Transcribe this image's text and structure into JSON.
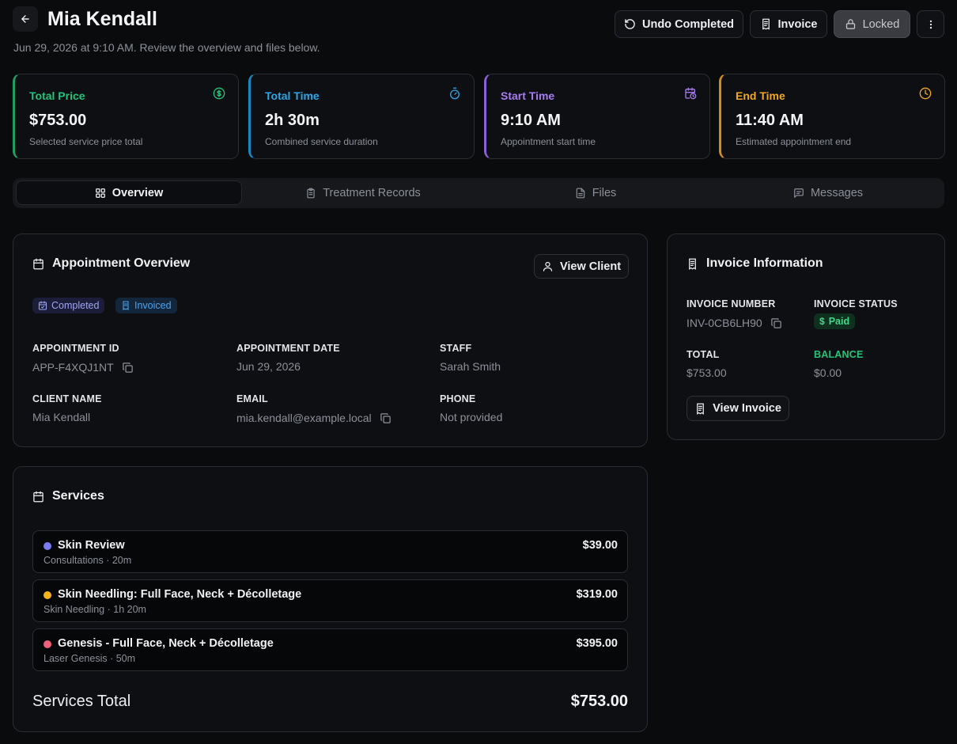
{
  "header": {
    "title": "Mia Kendall",
    "subtitle": "Jun 29, 2026 at 9:10 AM. Review the overview and files below.",
    "buttons": {
      "undo": "Undo Completed",
      "invoice": "Invoice",
      "locked": "Locked"
    }
  },
  "stats": [
    {
      "label": "Total Price",
      "value": "$753.00",
      "desc": "Selected service price total",
      "color": "#22c37a",
      "icon": "dollar-circle-icon"
    },
    {
      "label": "Total Time",
      "value": "2h 30m",
      "desc": "Combined service duration",
      "color": "#2ba7e8",
      "icon": "stopwatch-icon"
    },
    {
      "label": "Start Time",
      "value": "9:10 AM",
      "desc": "Appointment start time",
      "color": "#a67cf0",
      "icon": "calendar-clock-icon"
    },
    {
      "label": "End Time",
      "value": "11:40 AM",
      "desc": "Estimated appointment end",
      "color": "#f0a824",
      "icon": "clock-icon"
    }
  ],
  "tabs": [
    {
      "label": "Overview",
      "active": true,
      "icon": "grid-icon"
    },
    {
      "label": "Treatment Records",
      "active": false,
      "icon": "clipboard-icon"
    },
    {
      "label": "Files",
      "active": false,
      "icon": "file-icon"
    },
    {
      "label": "Messages",
      "active": false,
      "icon": "message-icon"
    }
  ],
  "overview": {
    "title": "Appointment Overview",
    "view_client": "View Client",
    "badges": {
      "completed": "Completed",
      "invoiced": "Invoiced"
    },
    "fields": {
      "appointment_id": {
        "label": "APPOINTMENT ID",
        "value": "APP-F4XQJ1NT"
      },
      "appointment_date": {
        "label": "APPOINTMENT DATE",
        "value": "Jun 29, 2026"
      },
      "staff": {
        "label": "STAFF",
        "value": "Sarah Smith"
      },
      "client_name": {
        "label": "CLIENT NAME",
        "value": "Mia Kendall"
      },
      "email": {
        "label": "EMAIL",
        "value": "mia.kendall@example.local"
      },
      "phone": {
        "label": "PHONE",
        "value": "Not provided"
      }
    }
  },
  "invoice": {
    "title": "Invoice Information",
    "number_label": "INVOICE NUMBER",
    "number": "INV-0CB6LH90",
    "status_label": "INVOICE STATUS",
    "status": "Paid",
    "total_label": "TOTAL",
    "total": "$753.00",
    "balance_label": "BALANCE",
    "balance": "$0.00",
    "view_button": "View Invoice"
  },
  "services": {
    "title": "Services",
    "items": [
      {
        "name": "Skin Review",
        "meta": "Consultations · 20m",
        "price": "$39.00",
        "color": "#7c7cf2"
      },
      {
        "name": "Skin Needling: Full Face, Neck + Décolletage",
        "meta": "Skin Needling · 1h 20m",
        "price": "$319.00",
        "color": "#f2b418"
      },
      {
        "name": "Genesis - Full Face, Neck + Décolletage",
        "meta": "Laser Genesis · 50m",
        "price": "$395.00",
        "color": "#f0607a"
      }
    ],
    "total_label": "Services Total",
    "total": "$753.00"
  }
}
